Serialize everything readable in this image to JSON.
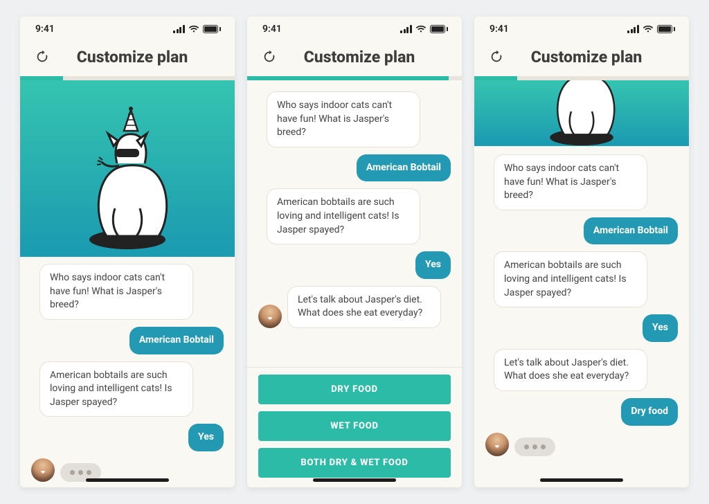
{
  "status": {
    "time": "9:41"
  },
  "header": {
    "title": "Customize plan"
  },
  "colors": {
    "accent_teal": "#2cbba6",
    "user_bubble": "#2399b3",
    "page_bg": "#faf8f3"
  },
  "screen1": {
    "messages": {
      "m1": "Who says indoor cats can't have fun! What is Jasper's breed?",
      "u1": "American Bobtail",
      "m2": "American bobtails are such loving and intelligent cats! Is Jasper spayed?",
      "u2": "Yes"
    }
  },
  "screen2": {
    "messages": {
      "m1": "Who says indoor cats can't have fun! What is Jasper's breed?",
      "u1": "American Bobtail",
      "m2": "American bobtails are such loving and intelligent cats! Is Jasper spayed?",
      "u2": "Yes",
      "m3": "Let's talk about Jasper's diet. What does she eat everyday?"
    },
    "options": {
      "o1": "DRY FOOD",
      "o2": "WET FOOD",
      "o3": "BOTH DRY & WET FOOD"
    }
  },
  "screen3": {
    "messages": {
      "m1": "Who says indoor cats can't have fun! What is Jasper's breed?",
      "u1": "American Bobtail",
      "m2": "American bobtails are such loving and intelligent cats! Is Jasper spayed?",
      "u2": "Yes",
      "m3": "Let's talk about Jasper's diet. What does she eat everyday?",
      "u3": "Dry food"
    }
  }
}
